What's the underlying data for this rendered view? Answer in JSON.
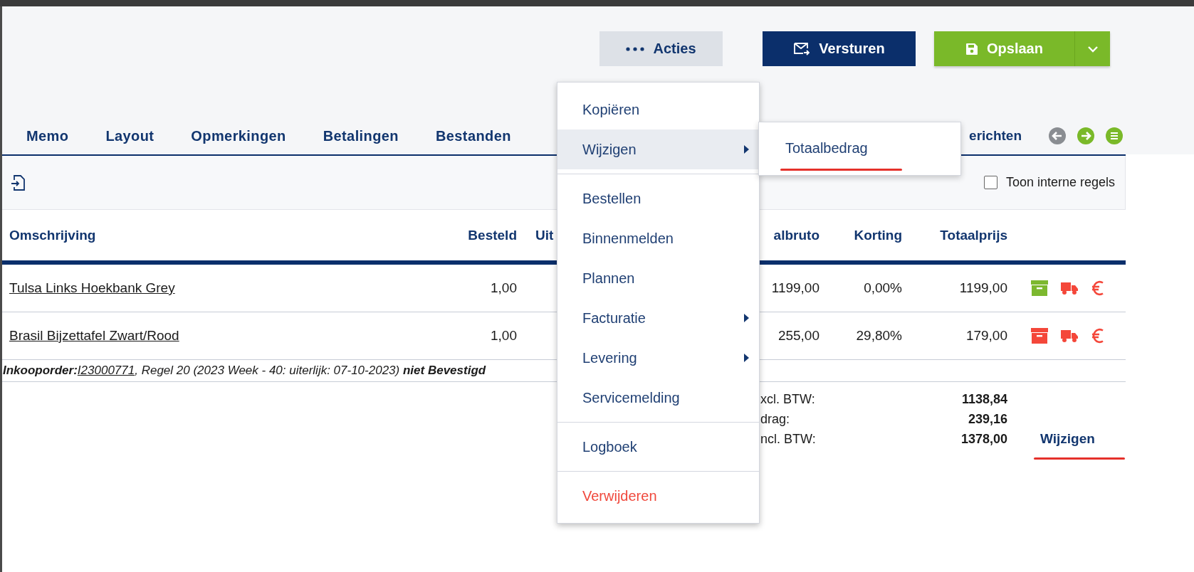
{
  "header_actions": [
    {
      "kind": "more",
      "label": "Acties"
    },
    {
      "kind": "send",
      "label": "Versturen"
    },
    {
      "kind": "save",
      "label": "Opslaan",
      "has_dropdown": true
    }
  ],
  "tabs": [
    {
      "label": "Memo"
    },
    {
      "label": "Layout"
    },
    {
      "label": "Opmerkingen"
    },
    {
      "label": "Betalingen"
    },
    {
      "label": "Bestanden"
    },
    {
      "label": "erichten"
    }
  ],
  "toolbar": {
    "show_internal": {
      "label": "Toon interne regels",
      "checked": false
    }
  },
  "table": {
    "columns": [
      "Omschrijving",
      "Besteld",
      "Uit",
      "albruto",
      "Korting",
      "Totaalprijs"
    ],
    "rows": [
      {
        "description": "Tulsa Links Hoekbank Grey",
        "ordered": "1,00",
        "gross": "1199,00",
        "discount": "0,00%",
        "total": "1199,00",
        "icons": [
          {
            "kind": "box",
            "color": "#7cb82f"
          },
          {
            "kind": "truck",
            "color": "#f4473a"
          },
          {
            "kind": "euro",
            "color": "#f4473a"
          }
        ]
      },
      {
        "description": "Brasil Bijzettafel Zwart/Rood",
        "ordered": "1,00",
        "gross": "255,00",
        "discount": "29,80%",
        "total": "179,00",
        "icons": [
          {
            "kind": "box",
            "color": "#f4473a"
          },
          {
            "kind": "truck",
            "color": "#f4473a"
          },
          {
            "kind": "euro",
            "color": "#f4473a"
          }
        ]
      }
    ],
    "note": {
      "label": "Inkooporder:",
      "link": "I23000771",
      "text": ", Regel 20 (2023 Week - 40: uiterlijk: 07-10-2023) **niet Bevestigd**"
    }
  },
  "totals": {
    "lines": [
      {
        "label": "xcl. BTW:",
        "value": "1138,84"
      },
      {
        "label": "drag:",
        "value": "239,16"
      },
      {
        "label": "ncl. BTW:",
        "value": "1378,00"
      }
    ],
    "edit_link": {
      "label": "Wijzigen",
      "annotated": true
    }
  },
  "menu": {
    "groups": [
      [
        {
          "label": "Kopiëren",
          "kind": "normal",
          "selected": false,
          "has_submenu": false
        },
        {
          "label": "Wijzigen",
          "kind": "normal",
          "selected": true,
          "has_submenu": true
        }
      ],
      [
        {
          "label": "Bestellen",
          "kind": "normal",
          "selected": false,
          "has_submenu": false
        },
        {
          "label": "Binnenmelden",
          "kind": "normal",
          "selected": false,
          "has_submenu": false
        },
        {
          "label": "Plannen",
          "kind": "normal",
          "selected": false,
          "has_submenu": false
        },
        {
          "label": "Facturatie",
          "kind": "normal",
          "selected": false,
          "has_submenu": true
        },
        {
          "label": "Levering",
          "kind": "normal",
          "selected": false,
          "has_submenu": true
        },
        {
          "label": "Servicemelding",
          "kind": "normal",
          "selected": false,
          "has_submenu": false
        }
      ],
      [
        {
          "label": "Logboek",
          "kind": "normal",
          "selected": false,
          "has_submenu": false
        }
      ],
      [
        {
          "label": "Verwijderen",
          "kind": "danger",
          "selected": false,
          "has_submenu": false
        }
      ]
    ]
  },
  "submenu": {
    "items": [
      {
        "label": "Totaalbedrag",
        "annotated": true
      }
    ]
  }
}
